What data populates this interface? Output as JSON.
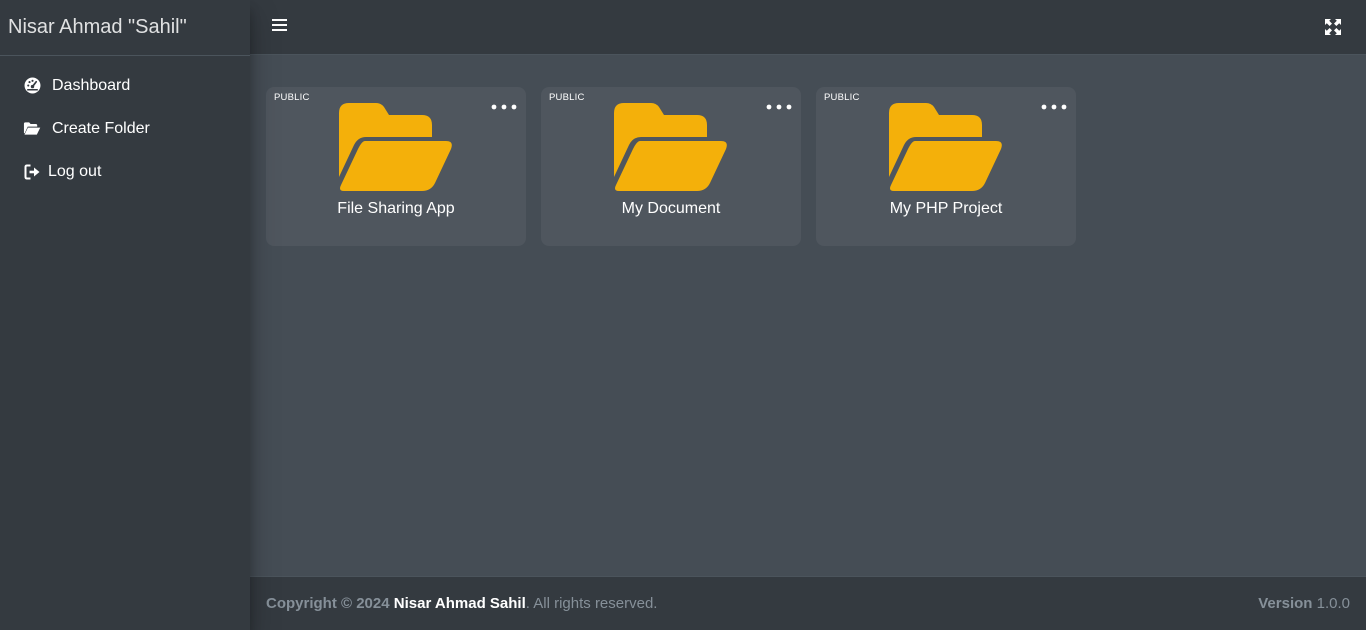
{
  "sidebar": {
    "brand": "Nisar Ahmad \"Sahil\"",
    "items": [
      {
        "label": "Dashboard",
        "icon": "dashboard-icon"
      },
      {
        "label": "Create Folder",
        "icon": "folder-open-icon"
      },
      {
        "label": "Log out",
        "icon": "logout-icon"
      }
    ]
  },
  "header": {
    "menu_icon": "hamburger-icon",
    "fullscreen_icon": "expand-icon"
  },
  "folders": [
    {
      "badge": "PUBLIC",
      "name": "File Sharing App"
    },
    {
      "badge": "PUBLIC",
      "name": "My Document"
    },
    {
      "badge": "PUBLIC",
      "name": "My PHP Project"
    }
  ],
  "footer": {
    "copyright": "Copyright © 2024",
    "author": "Nisar Ahmad Sahil",
    "rights": ". All rights reserved.",
    "version_label": "Version",
    "version_value": "1.0.0"
  },
  "colors": {
    "sidebar_bg": "#343a40",
    "content_bg": "#454d55",
    "card_bg": "#4f565e",
    "folder": "#f4b00a"
  }
}
